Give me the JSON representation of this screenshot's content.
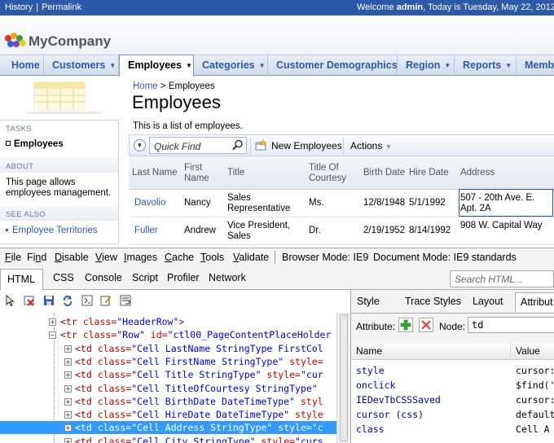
{
  "topbar": {
    "history": "History",
    "permalink": "Permalink",
    "welcome_prefix": "Welcome ",
    "user": "admin",
    "welcome_suffix": ", Today is Tuesday, May 22, 2012"
  },
  "brand": {
    "name": "MyCompany",
    "logo_colors": [
      "#d8352a",
      "#f3a21b",
      "#3a9b3a",
      "#2d6ac4",
      "#8a3fb0",
      "#e5d22a"
    ]
  },
  "nav": [
    {
      "label": "Home",
      "dropdown": false
    },
    {
      "label": "Customers",
      "dropdown": true
    },
    {
      "label": "Employees",
      "dropdown": true,
      "active": true
    },
    {
      "label": "Categories",
      "dropdown": true
    },
    {
      "label": "Customer Demographics",
      "dropdown": false
    },
    {
      "label": "Region",
      "dropdown": true
    },
    {
      "label": "Reports",
      "dropdown": true
    },
    {
      "label": "Memb",
      "dropdown": false
    }
  ],
  "sidebar": {
    "tasks_title": "TASKS",
    "tasks_item": "Employees",
    "about_title": "ABOUT",
    "about_text": "This page allows employees management.",
    "see_also_title": "SEE ALSO",
    "see_also_item": "Employee Territories"
  },
  "main": {
    "breadcrumb_home": "Home",
    "breadcrumb_sep": ">",
    "breadcrumb_current": "Employees",
    "title": "Employees",
    "description": "This is a list of employees.",
    "quick_find_placeholder": "Quick Find",
    "new_button": "New Employees",
    "actions": "Actions"
  },
  "grid": {
    "columns": [
      "Last Name",
      "First Name",
      "Title",
      "Title Of Courtesy",
      "Birth Date",
      "Hire Date",
      "Address"
    ],
    "rows": [
      [
        "Davolio",
        "Nancy",
        "Sales Representative",
        "Ms.",
        "12/8/1948",
        "5/1/1992",
        "507 - 20th Ave. E. Apt. 2A"
      ],
      [
        "Fuller",
        "Andrew",
        "Vice President, Sales",
        "Dr.",
        "2/19/1952",
        "8/14/1992",
        "908 W. Capital Way"
      ]
    ]
  },
  "devtools": {
    "menu": [
      "File",
      "Find",
      "Disable",
      "View",
      "Images",
      "Cache",
      "Tools",
      "Validate"
    ],
    "menu_underline": [
      "F",
      "n",
      "D",
      "V",
      "I",
      "C",
      "T",
      "V"
    ],
    "browser_mode": "Browser Mode: IE9",
    "document_mode": "Document Mode: IE9 standards",
    "tabs": [
      "HTML",
      "CSS",
      "Console",
      "Script",
      "Profiler",
      "Network"
    ],
    "search_placeholder": "Search HTML...",
    "tree": [
      {
        "indent": 0,
        "segments": [
          [
            "tag",
            "<tr "
          ],
          [
            "an",
            "class="
          ],
          [
            "av",
            "\"HeaderRow\""
          ],
          [
            "tag",
            ">"
          ]
        ]
      },
      {
        "indent": 0,
        "expanded": true,
        "segments": [
          [
            "tag",
            "<tr "
          ],
          [
            "an",
            "class="
          ],
          [
            "av",
            "\"Row\""
          ],
          [
            "an",
            " id="
          ],
          [
            "av",
            "\"ctl00_PageContentPlaceHolder"
          ]
        ]
      },
      {
        "indent": 1,
        "segments": [
          [
            "tag",
            "<td "
          ],
          [
            "an",
            "class="
          ],
          [
            "av",
            "\"Cell  LastName StringType FirstCol"
          ]
        ]
      },
      {
        "indent": 1,
        "segments": [
          [
            "tag",
            "<td "
          ],
          [
            "an",
            "class="
          ],
          [
            "av",
            "\"Cell  FirstName StringType\""
          ],
          [
            "an",
            " style="
          ]
        ]
      },
      {
        "indent": 1,
        "segments": [
          [
            "tag",
            "<td "
          ],
          [
            "an",
            "class="
          ],
          [
            "av",
            "\"Cell  Title StringType\""
          ],
          [
            "an",
            " style="
          ],
          [
            "av",
            "\"cur"
          ]
        ]
      },
      {
        "indent": 1,
        "segments": [
          [
            "tag",
            "<td "
          ],
          [
            "an",
            "class="
          ],
          [
            "av",
            "\"Cell  TitleOfCourtesy StringType\""
          ]
        ]
      },
      {
        "indent": 1,
        "segments": [
          [
            "tag",
            "<td "
          ],
          [
            "an",
            "class="
          ],
          [
            "av",
            "\"Cell  BirthDate DateTimeType\""
          ],
          [
            "an",
            " styl"
          ]
        ]
      },
      {
        "indent": 1,
        "segments": [
          [
            "tag",
            "<td "
          ],
          [
            "an",
            "class="
          ],
          [
            "av",
            "\"Cell  HireDate DateTimeType\""
          ],
          [
            "an",
            " style"
          ]
        ]
      },
      {
        "indent": 1,
        "selected": true,
        "segments": [
          [
            "tag",
            "<td "
          ],
          [
            "an",
            "class="
          ],
          [
            "av",
            "\"Cell  Address StringType\""
          ],
          [
            "an",
            " style="
          ],
          [
            "av",
            "\"c"
          ]
        ]
      },
      {
        "indent": 1,
        "segments": [
          [
            "tag",
            "<td "
          ],
          [
            "an",
            "class="
          ],
          [
            "av",
            "\"Cell  City StringType\""
          ],
          [
            "an",
            " style="
          ],
          [
            "av",
            "\"curs"
          ]
        ]
      }
    ],
    "right_tabs": [
      "Style",
      "Trace Styles",
      "Layout",
      "Attribut"
    ],
    "attribute_label": "Attribute:",
    "node_label": "Node:",
    "node_value": "td",
    "attr_columns": [
      "Name",
      "Value"
    ],
    "attrs": [
      [
        "style",
        "cursor:"
      ],
      [
        "onclick",
        "$find('"
      ],
      [
        "IEDevTbCSSSaved",
        "cursor:"
      ],
      [
        "cursor (css)",
        "default"
      ],
      [
        "class",
        "Cell  A"
      ]
    ]
  }
}
